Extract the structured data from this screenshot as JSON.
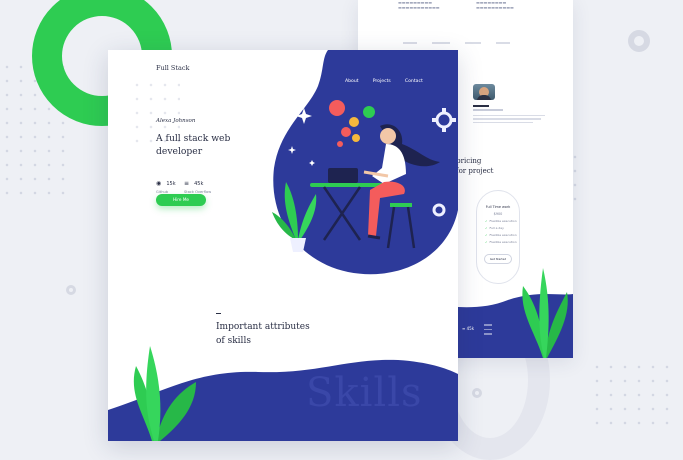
{
  "front": {
    "brand": "Full Stack",
    "nav": [
      "About",
      "Projects",
      "Contact"
    ],
    "signature": "Alexa Johnson",
    "headline_line1": "A full stack web",
    "headline_line2": "developer",
    "stats": [
      {
        "icon": "github-icon",
        "value": "15k",
        "label": "Github"
      },
      {
        "icon": "stack-overflow-icon",
        "value": "45k",
        "label": "Stack Overflow"
      }
    ],
    "cta_label": "Hire Me",
    "section_title_line1": "Important attributes",
    "section_title_line2": "of skills",
    "watermark": "Skills"
  },
  "back": {
    "pricing_line1": "y pricing",
    "pricing_line2": "for project",
    "card_title": "Full Time work",
    "card_sub": "$900",
    "card_features": [
      "Flexible execution",
      "Full a day",
      "Flexible execution",
      "Flexible execution"
    ],
    "card_button": "Get Started",
    "footer_stat": "45k"
  },
  "colors": {
    "accent_blue": "#2d3a9a",
    "accent_green": "#2ecc52",
    "coral": "#f45c5c"
  }
}
